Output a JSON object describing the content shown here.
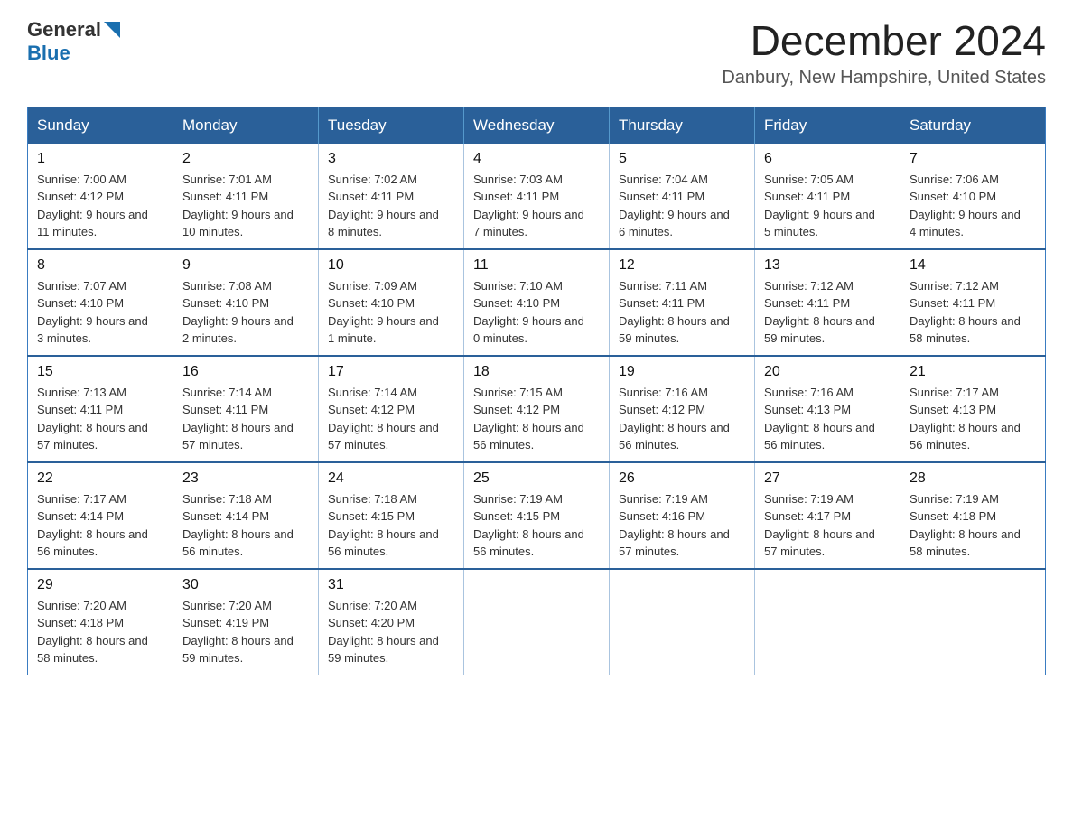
{
  "header": {
    "logo_general": "General",
    "logo_blue": "Blue",
    "title": "December 2024",
    "subtitle": "Danbury, New Hampshire, United States"
  },
  "weekdays": [
    "Sunday",
    "Monday",
    "Tuesday",
    "Wednesday",
    "Thursday",
    "Friday",
    "Saturday"
  ],
  "weeks": [
    [
      {
        "day": "1",
        "sunrise": "7:00 AM",
        "sunset": "4:12 PM",
        "daylight": "9 hours and 11 minutes."
      },
      {
        "day": "2",
        "sunrise": "7:01 AM",
        "sunset": "4:11 PM",
        "daylight": "9 hours and 10 minutes."
      },
      {
        "day": "3",
        "sunrise": "7:02 AM",
        "sunset": "4:11 PM",
        "daylight": "9 hours and 8 minutes."
      },
      {
        "day": "4",
        "sunrise": "7:03 AM",
        "sunset": "4:11 PM",
        "daylight": "9 hours and 7 minutes."
      },
      {
        "day": "5",
        "sunrise": "7:04 AM",
        "sunset": "4:11 PM",
        "daylight": "9 hours and 6 minutes."
      },
      {
        "day": "6",
        "sunrise": "7:05 AM",
        "sunset": "4:11 PM",
        "daylight": "9 hours and 5 minutes."
      },
      {
        "day": "7",
        "sunrise": "7:06 AM",
        "sunset": "4:10 PM",
        "daylight": "9 hours and 4 minutes."
      }
    ],
    [
      {
        "day": "8",
        "sunrise": "7:07 AM",
        "sunset": "4:10 PM",
        "daylight": "9 hours and 3 minutes."
      },
      {
        "day": "9",
        "sunrise": "7:08 AM",
        "sunset": "4:10 PM",
        "daylight": "9 hours and 2 minutes."
      },
      {
        "day": "10",
        "sunrise": "7:09 AM",
        "sunset": "4:10 PM",
        "daylight": "9 hours and 1 minute."
      },
      {
        "day": "11",
        "sunrise": "7:10 AM",
        "sunset": "4:10 PM",
        "daylight": "9 hours and 0 minutes."
      },
      {
        "day": "12",
        "sunrise": "7:11 AM",
        "sunset": "4:11 PM",
        "daylight": "8 hours and 59 minutes."
      },
      {
        "day": "13",
        "sunrise": "7:12 AM",
        "sunset": "4:11 PM",
        "daylight": "8 hours and 59 minutes."
      },
      {
        "day": "14",
        "sunrise": "7:12 AM",
        "sunset": "4:11 PM",
        "daylight": "8 hours and 58 minutes."
      }
    ],
    [
      {
        "day": "15",
        "sunrise": "7:13 AM",
        "sunset": "4:11 PM",
        "daylight": "8 hours and 57 minutes."
      },
      {
        "day": "16",
        "sunrise": "7:14 AM",
        "sunset": "4:11 PM",
        "daylight": "8 hours and 57 minutes."
      },
      {
        "day": "17",
        "sunrise": "7:14 AM",
        "sunset": "4:12 PM",
        "daylight": "8 hours and 57 minutes."
      },
      {
        "day": "18",
        "sunrise": "7:15 AM",
        "sunset": "4:12 PM",
        "daylight": "8 hours and 56 minutes."
      },
      {
        "day": "19",
        "sunrise": "7:16 AM",
        "sunset": "4:12 PM",
        "daylight": "8 hours and 56 minutes."
      },
      {
        "day": "20",
        "sunrise": "7:16 AM",
        "sunset": "4:13 PM",
        "daylight": "8 hours and 56 minutes."
      },
      {
        "day": "21",
        "sunrise": "7:17 AM",
        "sunset": "4:13 PM",
        "daylight": "8 hours and 56 minutes."
      }
    ],
    [
      {
        "day": "22",
        "sunrise": "7:17 AM",
        "sunset": "4:14 PM",
        "daylight": "8 hours and 56 minutes."
      },
      {
        "day": "23",
        "sunrise": "7:18 AM",
        "sunset": "4:14 PM",
        "daylight": "8 hours and 56 minutes."
      },
      {
        "day": "24",
        "sunrise": "7:18 AM",
        "sunset": "4:15 PM",
        "daylight": "8 hours and 56 minutes."
      },
      {
        "day": "25",
        "sunrise": "7:19 AM",
        "sunset": "4:15 PM",
        "daylight": "8 hours and 56 minutes."
      },
      {
        "day": "26",
        "sunrise": "7:19 AM",
        "sunset": "4:16 PM",
        "daylight": "8 hours and 57 minutes."
      },
      {
        "day": "27",
        "sunrise": "7:19 AM",
        "sunset": "4:17 PM",
        "daylight": "8 hours and 57 minutes."
      },
      {
        "day": "28",
        "sunrise": "7:19 AM",
        "sunset": "4:18 PM",
        "daylight": "8 hours and 58 minutes."
      }
    ],
    [
      {
        "day": "29",
        "sunrise": "7:20 AM",
        "sunset": "4:18 PM",
        "daylight": "8 hours and 58 minutes."
      },
      {
        "day": "30",
        "sunrise": "7:20 AM",
        "sunset": "4:19 PM",
        "daylight": "8 hours and 59 minutes."
      },
      {
        "day": "31",
        "sunrise": "7:20 AM",
        "sunset": "4:20 PM",
        "daylight": "8 hours and 59 minutes."
      },
      null,
      null,
      null,
      null
    ]
  ],
  "labels": {
    "sunrise": "Sunrise:",
    "sunset": "Sunset:",
    "daylight": "Daylight:"
  }
}
